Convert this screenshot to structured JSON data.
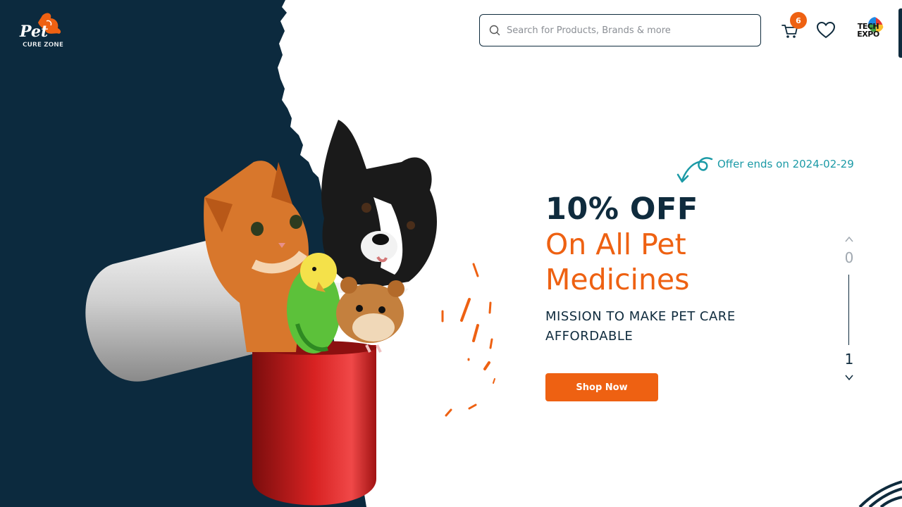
{
  "brand": {
    "logo_word": "Pet",
    "logo_sub": "CURE ZONE",
    "accent": "#ee6112",
    "dark": "#0f2b3d",
    "teal": "#1b9aa6"
  },
  "header": {
    "search_placeholder": "Search for Products, Brands & more",
    "search_icon": "search-icon",
    "cart_icon": "cart-icon",
    "cart_count": "6",
    "wishlist_icon": "heart-icon",
    "sponsor_line1": "TECH",
    "sponsor_line2": "EXPO"
  },
  "hero": {
    "offer_note": "Offer ends on 2024-02-29",
    "headline": "10% OFF",
    "subheadline": "On All Pet Medicines",
    "mission": "MISSION TO MAKE PET CARE AFFORDABLE",
    "cta_label": "Shop Now",
    "image_subject": "cat, dog, budgie and hamster emerging from an open capsule"
  },
  "slider": {
    "current": "0",
    "next": "1",
    "up_icon": "chevron-up-icon",
    "down_icon": "chevron-down-icon"
  }
}
